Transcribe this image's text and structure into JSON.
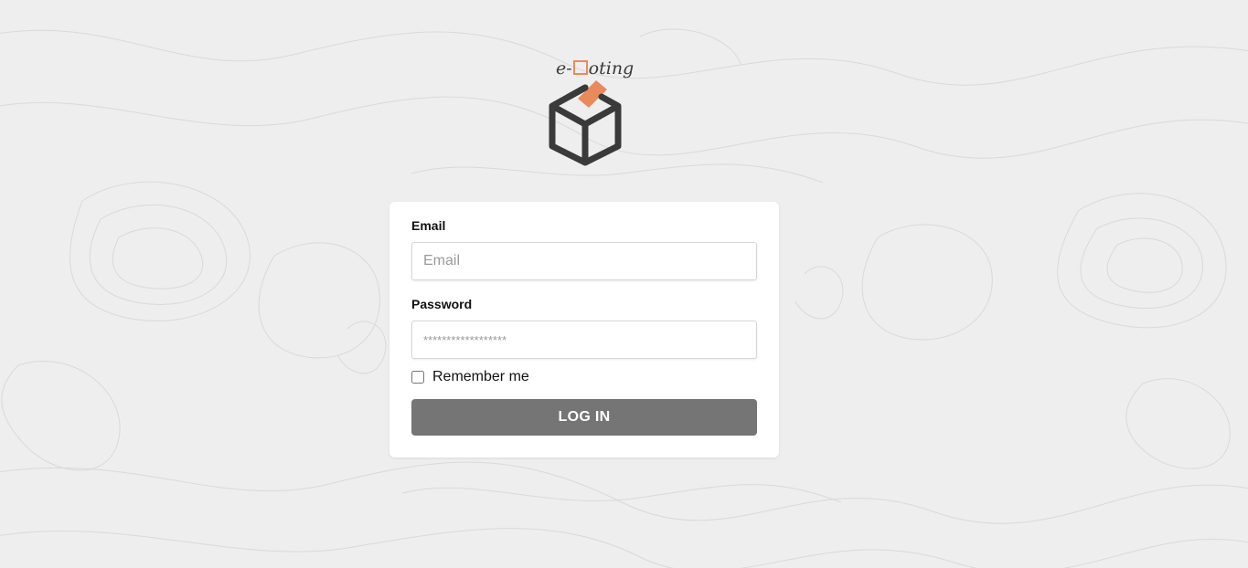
{
  "logo": {
    "text_prefix": "e-",
    "text_suffix": "oting",
    "icon": "ballot-box-icon",
    "accent_color": "#e98a5c"
  },
  "form": {
    "email_label": "Email",
    "email_placeholder": "Email",
    "password_label": "Password",
    "password_placeholder": "******************",
    "remember_label": "Remember me",
    "remember_checked": false,
    "login_label": "LOG IN"
  },
  "colors": {
    "background": "#eeeeee",
    "card": "#ffffff",
    "button": "#757575",
    "accent": "#e98a5c",
    "logo_dark": "#3a3a3a"
  }
}
